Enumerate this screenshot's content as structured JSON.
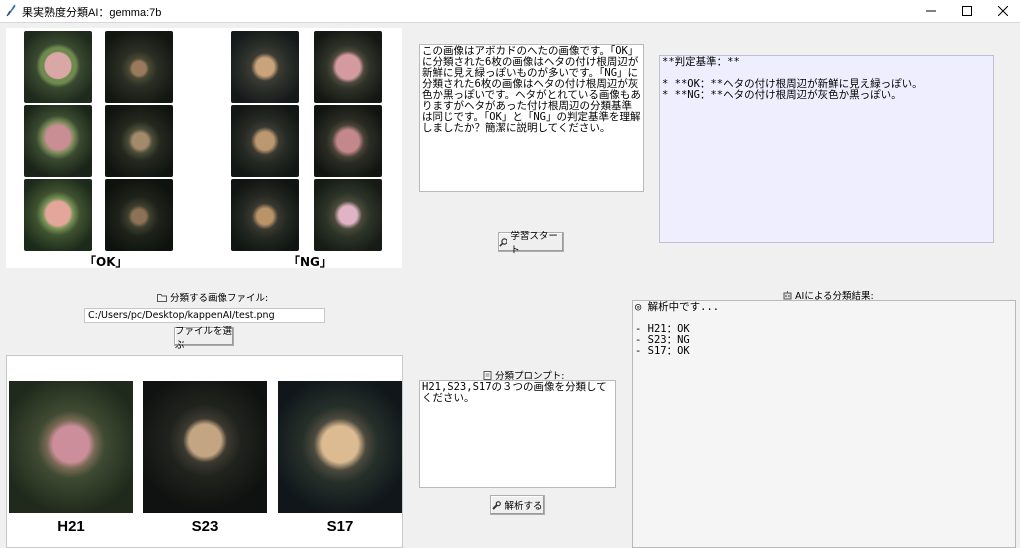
{
  "window": {
    "title": "果実熟度分類AI：gemma:7b",
    "minimize_icon": "minimize-icon",
    "maximize_icon": "maximize-icon",
    "close_icon": "close-icon"
  },
  "reference_panel": {
    "ok_caption": "「OK」",
    "ng_caption": "「NG」"
  },
  "file_section": {
    "label": "分類する画像ファイル:",
    "label_icon": "folder-icon",
    "path_value": "C:/Users/pc/Desktop/kappenAI/test.png",
    "choose_button": "ファイルを選ぶ"
  },
  "test_images": [
    {
      "label": "H21"
    },
    {
      "label": "S23"
    },
    {
      "label": "S17"
    }
  ],
  "learning": {
    "prompt_text": "この画像はアボカドのへたの画像です。「OK」に分類された6枚の画像はヘタの付け根周辺が新鮮に見え緑っぽいものが多いです。「NG」に分類された6枚の画像はヘタの付け根周辺が灰色か黒っぽいです。ヘタがとれている画像もありますがヘタがあった付け根周辺の分類基準は同じです。「OK」と「NG」の判定基準を理解しましたか？簡潔に説明してください。",
    "start_button": "学習スタート",
    "start_icon": "magnifier-icon"
  },
  "criteria": {
    "text": "**判定基準：**\n\n* **OK：**ヘタの付け根周辺が新鮮に見え緑っぽい。\n* **NG：**ヘタの付け根周辺が灰色か黒っぽい。"
  },
  "classify": {
    "label": "分類プロンプト:",
    "label_icon": "memo-icon",
    "prompt_text": "H21,S23,S17の３つの画像を分類してください。",
    "analyze_button": "解析する",
    "analyze_icon": "wrench-icon"
  },
  "results": {
    "label": "AIによる分類結果:",
    "label_icon": "robot-icon",
    "text": "◎ 解析中です...\n\n- H21：OK\n- S23：NG\n- S17：OK"
  }
}
